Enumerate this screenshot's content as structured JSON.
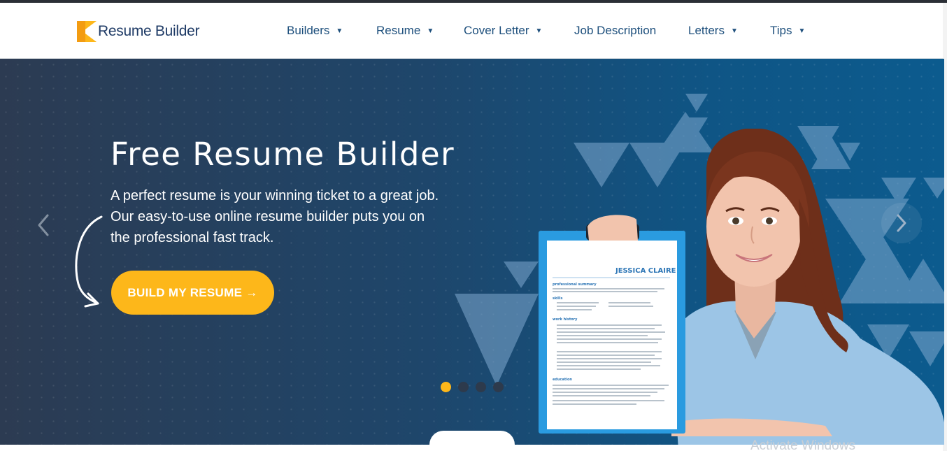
{
  "brand": {
    "name": "Resume Builder",
    "logo_icon": "resume-builder-logo-icon"
  },
  "nav": {
    "items": [
      {
        "label": "Builders",
        "has_dropdown": true
      },
      {
        "label": "Resume",
        "has_dropdown": true
      },
      {
        "label": "Cover Letter",
        "has_dropdown": true
      },
      {
        "label": "Job Description",
        "has_dropdown": false
      },
      {
        "label": "Letters",
        "has_dropdown": true
      },
      {
        "label": "Tips",
        "has_dropdown": true
      }
    ]
  },
  "hero": {
    "title": "Free Resume Builder",
    "subtitle_lines": [
      "A perfect resume is your winning ticket to a great job.",
      "Our easy-to-use online resume builder puts you on",
      "the professional fast track."
    ],
    "cta_label": "BUILD MY RESUME →",
    "resume_name": "JESSICA CLAIRE",
    "resume_headings": [
      "professional summary",
      "skills",
      "work history",
      "education"
    ]
  },
  "carousel": {
    "slide_count": 4,
    "active_index": 0
  },
  "overlay": {
    "watermark": "Activate Windows"
  },
  "colors": {
    "accent": "#fdb71a",
    "nav_text": "#1d4f7c",
    "hero_dark": "#2c3b52",
    "hero_blue": "#0c5b8e",
    "clipboard": "#2a9be0"
  }
}
